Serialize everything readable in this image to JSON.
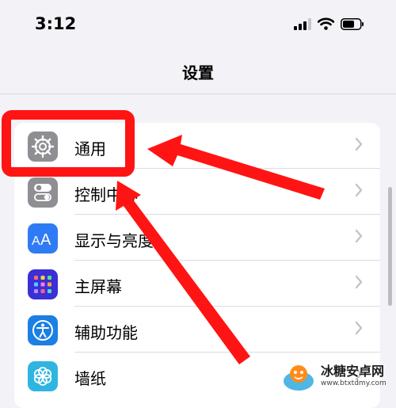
{
  "status_bar": {
    "time": "3:12",
    "icons": [
      "cellular-signal-icon",
      "wifi-icon",
      "battery-icon"
    ]
  },
  "nav": {
    "title": "设置"
  },
  "settings": {
    "items": [
      {
        "label": "通用",
        "icon": "gear-icon",
        "icon_color": "#8e8e93"
      },
      {
        "label": "控制中心",
        "icon": "toggles-icon",
        "icon_color": "#8e8e93"
      },
      {
        "label": "显示与亮度",
        "icon": "text-size-icon",
        "icon_color": "#2f7bf5"
      },
      {
        "label": "主屏幕",
        "icon": "app-grid-icon",
        "icon_color": "#3b2fd6"
      },
      {
        "label": "辅助功能",
        "icon": "accessibility-icon",
        "icon_color": "#1b7fe3"
      },
      {
        "label": "墙纸",
        "icon": "flower-icon",
        "icon_color": "#2fb5e0"
      }
    ]
  },
  "annotation": {
    "color": "#ff1414"
  },
  "watermark": {
    "name": "冰糖安卓网",
    "url": "www.btxtdmy.com"
  }
}
